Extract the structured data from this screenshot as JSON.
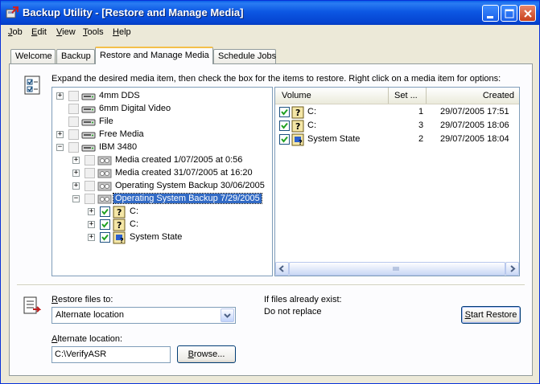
{
  "window": {
    "title": "Backup Utility - [Restore and Manage Media]"
  },
  "menu": {
    "items": [
      {
        "label": "Job",
        "accel": "J",
        "rest": "ob"
      },
      {
        "label": "Edit",
        "accel": "E",
        "rest": "dit"
      },
      {
        "label": "View",
        "accel": "V",
        "rest": "iew"
      },
      {
        "label": "Tools",
        "accel": "T",
        "rest": "ools"
      },
      {
        "label": "Help",
        "accel": "H",
        "rest": "elp"
      }
    ]
  },
  "tabs": [
    {
      "label": "Welcome",
      "active": false
    },
    {
      "label": "Backup",
      "active": false
    },
    {
      "label": "Restore and Manage Media",
      "active": true
    },
    {
      "label": "Schedule Jobs",
      "active": false
    }
  ],
  "instruction": "Expand the desired media item, then check the box for the items to restore. Right click on a media item for options:",
  "tree": {
    "items": [
      {
        "label": "4mm DDS",
        "expander": "+",
        "icon": "tape-drive-icon"
      },
      {
        "label": "6mm Digital Video",
        "expander": "",
        "icon": "tape-drive-icon"
      },
      {
        "label": "File",
        "expander": "",
        "icon": "tape-drive-icon"
      },
      {
        "label": "Free Media",
        "expander": "+",
        "icon": "tape-drive-icon"
      },
      {
        "label": "IBM 3480",
        "expander": "−",
        "icon": "tape-drive-icon"
      },
      {
        "label": "Media created 1/07/2005 at 0:56",
        "expander": "+",
        "icon": "tape-cartridge-icon"
      },
      {
        "label": "Media created 31/07/2005 at 16:20",
        "expander": "+",
        "icon": "tape-cartridge-icon"
      },
      {
        "label": "Operating System Backup 30/06/2005",
        "expander": "+",
        "icon": "tape-cartridge-icon"
      },
      {
        "label": "Operating System Backup 7/29/2005",
        "expander": "−",
        "icon": "tape-cartridge-icon",
        "selected": true
      },
      {
        "label": "C:",
        "expander": "+",
        "icon": "drive-c-icon",
        "checked": true
      },
      {
        "label": "C:",
        "expander": "+",
        "icon": "drive-c-icon",
        "checked": true
      },
      {
        "label": "System State",
        "expander": "+",
        "icon": "system-state-icon",
        "checked": true
      }
    ]
  },
  "list": {
    "columns": [
      "Volume",
      "Set ...",
      "Created"
    ],
    "rows": [
      {
        "volume": "C:",
        "set": "1",
        "created": "29/07/2005 17:51",
        "checked": true,
        "icon": "drive-c-icon"
      },
      {
        "volume": "C:",
        "set": "3",
        "created": "29/07/2005 18:06",
        "checked": true,
        "icon": "drive-c-icon"
      },
      {
        "volume": "System State",
        "set": "2",
        "created": "29/07/2005 18:04",
        "checked": true,
        "icon": "system-state-icon"
      }
    ]
  },
  "restore": {
    "restore_to_label": "Restore files to:",
    "restore_to_value": "Alternate location",
    "if_exist_label": "If files already exist:",
    "if_exist_value": "Do not replace",
    "alt_location_label": "Alternate location:",
    "alt_location_value": "C:\\VerifyASR",
    "browse_label": "Browse...",
    "start_label": "Start Restore"
  },
  "colors": {
    "titlebar": "#0a5fe8",
    "selection": "#316ac5",
    "active_tab_accent": "#f4c04a"
  }
}
